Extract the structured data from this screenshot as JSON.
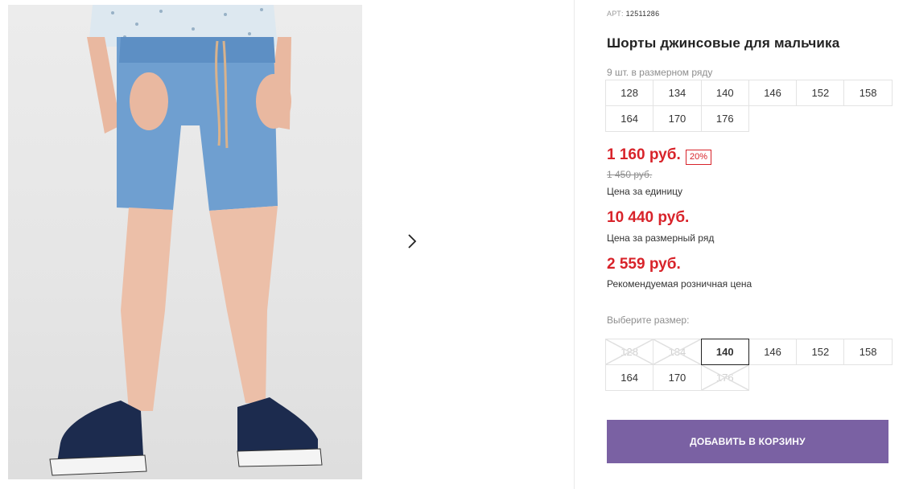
{
  "product": {
    "sku_label": "АРТ:",
    "sku": "12511286",
    "title": "Шорты джинсовые для мальчика",
    "range_count_label": "9 шт. в размерном ряду",
    "range_sizes": [
      "128",
      "134",
      "140",
      "146",
      "152",
      "158",
      "164",
      "170",
      "176"
    ]
  },
  "pricing": {
    "unit_price": "1 160 руб.",
    "discount_badge": "20%",
    "old_price": "1 450 руб.",
    "unit_price_label": "Цена за единицу",
    "range_price": "10 440 руб.",
    "range_price_label": "Цена за размерный ряд",
    "retail_price": "2 559 руб.",
    "retail_price_label": "Рекомендуемая розничная цена",
    "accent_color": "#d8232a"
  },
  "size_selector": {
    "label": "Выберите размер:",
    "options": [
      {
        "size": "128",
        "state": "disabled"
      },
      {
        "size": "134",
        "state": "disabled"
      },
      {
        "size": "140",
        "state": "selected"
      },
      {
        "size": "146",
        "state": "available"
      },
      {
        "size": "152",
        "state": "available"
      },
      {
        "size": "158",
        "state": "available"
      },
      {
        "size": "164",
        "state": "available"
      },
      {
        "size": "170",
        "state": "available"
      },
      {
        "size": "176",
        "state": "disabled"
      }
    ]
  },
  "cart": {
    "add_button_label": "ДОБАВИТЬ В КОРЗИНУ",
    "button_color": "#7a61a3"
  },
  "gallery": {
    "next_icon": "chevron-right-icon"
  }
}
